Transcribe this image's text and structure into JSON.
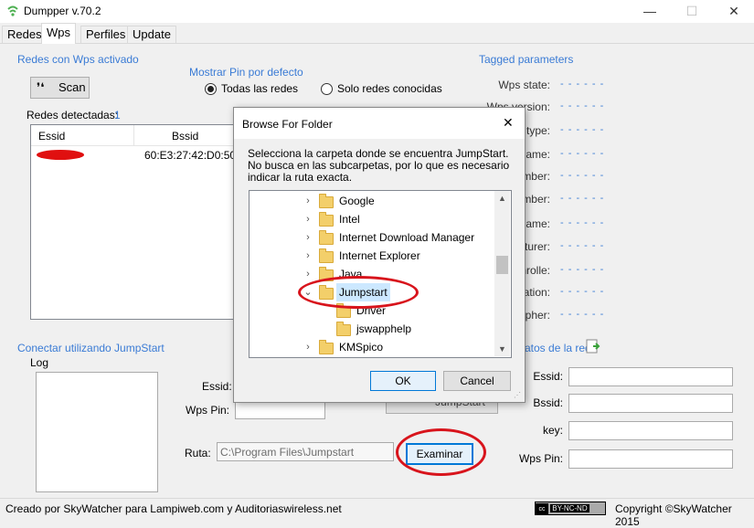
{
  "window": {
    "title": "Dumpper v.70.2",
    "minimize": "—",
    "maximize": "☐",
    "close": "✕"
  },
  "tabs": [
    "Redes",
    "Wps",
    "Perfiles",
    "Update"
  ],
  "wps": {
    "redes_wps_label": "Redes con Wps activado",
    "scan_label": "Scan",
    "mostrar_pin_label": "Mostrar Pin por defecto",
    "radio_todas": "Todas las redes",
    "radio_solo": "Solo redes conocidas",
    "redes_detectadas_label": "Redes detectadas:",
    "redes_detectadas_count": "1",
    "table": {
      "headers": [
        "Essid",
        "Bssid"
      ],
      "rows": [
        {
          "essid": "",
          "bssid": "60:E3:27:42:D0:50"
        }
      ]
    },
    "tagged_title": "Tagged parameters",
    "tagged_rows": [
      {
        "label": "Wps state:",
        "value": "- - - - - -"
      },
      {
        "label": "Wps version:",
        "value": "- - - - - -"
      },
      {
        "label": "type:",
        "value": "- - - - - -"
      },
      {
        "label": "name:",
        "value": "- - - - - -"
      },
      {
        "label": "mber:",
        "value": "- - - - - -"
      },
      {
        "label": "mber:",
        "value": "- - - - - -"
      },
      {
        "label": "name:",
        "value": "- - - - - -"
      },
      {
        "label": "turer:",
        "value": "- - - - - -"
      },
      {
        "label": "nrolle:",
        "value": "- - - - - -"
      },
      {
        "label": "ation:",
        "value": "- - - - - -"
      },
      {
        "label": "pher:",
        "value": "- - - - - -"
      }
    ],
    "conectar_label": "Conectar utilizando JumpStart",
    "log_label": "Log",
    "essid_label": "Essid:",
    "wpspin_label": "Wps Pin:",
    "jumpstart_btn": "JumpStart",
    "ruta_label": "Ruta:",
    "ruta_value": "C:\\Program Files\\Jumpstart",
    "examinar_btn": "Examinar",
    "datos_red_label": "atos de la red",
    "right_fields": [
      {
        "label": "Essid:",
        "value": ""
      },
      {
        "label": "Bssid:",
        "value": ""
      },
      {
        "label": "key:",
        "value": ""
      },
      {
        "label": "Wps Pin:",
        "value": ""
      }
    ]
  },
  "footer": {
    "left": "Creado por SkyWatcher para Lampiweb.com y Auditoriaswireless.net",
    "cc_badge": "BY-NC-ND",
    "right": "Copyright ©SkyWatcher 2015"
  },
  "dialog": {
    "title": "Browse For Folder",
    "close": "✕",
    "message": "Selecciona la carpeta donde se encuentra JumpStart. No busca en las subcarpetas, por lo que es necesario indicar la ruta exacta.",
    "folders": [
      {
        "name": "Google",
        "expander": "›",
        "level": 0
      },
      {
        "name": "Intel",
        "expander": "›",
        "level": 0
      },
      {
        "name": "Internet Download Manager",
        "expander": "›",
        "level": 0
      },
      {
        "name": "Internet Explorer",
        "expander": "›",
        "level": 0
      },
      {
        "name": "Java",
        "expander": "›",
        "level": 0
      },
      {
        "name": "Jumpstart",
        "expander": "⌄",
        "level": 0,
        "selected": true
      },
      {
        "name": "Driver",
        "expander": "",
        "level": 1
      },
      {
        "name": "jswapphelp",
        "expander": "",
        "level": 1
      },
      {
        "name": "KMSpico",
        "expander": "›",
        "level": 0
      }
    ],
    "ok": "OK",
    "cancel": "Cancel"
  },
  "colors": {
    "accent": "#3a7bd5",
    "annotation": "#d8141c",
    "selection": "#cce8ff"
  }
}
